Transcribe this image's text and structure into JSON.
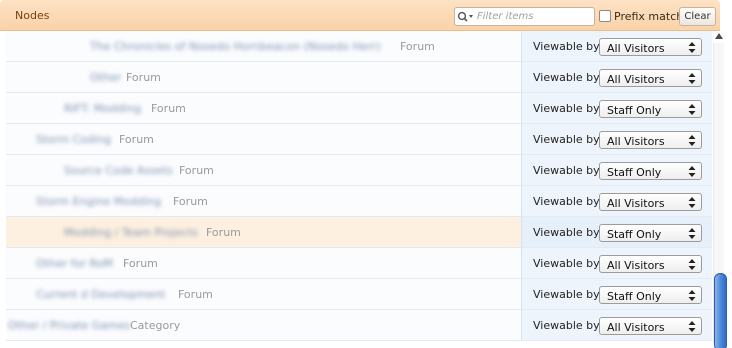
{
  "header": {
    "title": "Nodes",
    "search_placeholder": "Filter items",
    "prefix_match_label": "Prefix match",
    "prefix_match_checked": false,
    "clear_label": "Clear",
    "header_color": "#f9d3a9"
  },
  "permission_label": "Viewable by:",
  "rows": [
    {
      "name": "The Chronicles of Nosedo Hornbeacon (Nosedo Herr)",
      "type": "Forum",
      "value": "All Visitors",
      "highlighted": false
    },
    {
      "name": "Other",
      "type": "Forum",
      "value": "All Visitors",
      "highlighted": false
    },
    {
      "name": "RIFT: Modding",
      "type": "Forum",
      "value": "Staff Only",
      "highlighted": false
    },
    {
      "name": "Storm Coding",
      "type": "Forum",
      "value": "All Visitors",
      "highlighted": false
    },
    {
      "name": "Source Code Assets",
      "type": "Forum",
      "value": "Staff Only",
      "highlighted": false
    },
    {
      "name": "Storm Engine Modding",
      "type": "Forum",
      "value": "All Visitors",
      "highlighted": false
    },
    {
      "name": "Modding / Team Projects",
      "type": "Forum",
      "value": "Staff Only",
      "highlighted": true
    },
    {
      "name": "Other for RoM",
      "type": "Forum",
      "value": "All Visitors",
      "highlighted": false
    },
    {
      "name": "Current d Development",
      "type": "Forum",
      "value": "Staff Only",
      "highlighted": false
    },
    {
      "name": "Other / Private Games",
      "type": "Category",
      "value": "All Visitors",
      "highlighted": false
    }
  ],
  "colors": {
    "highlight_row": "#fdf0e0",
    "node_link": "#7f93b0",
    "scroll_thumb": "#4a86d8"
  }
}
